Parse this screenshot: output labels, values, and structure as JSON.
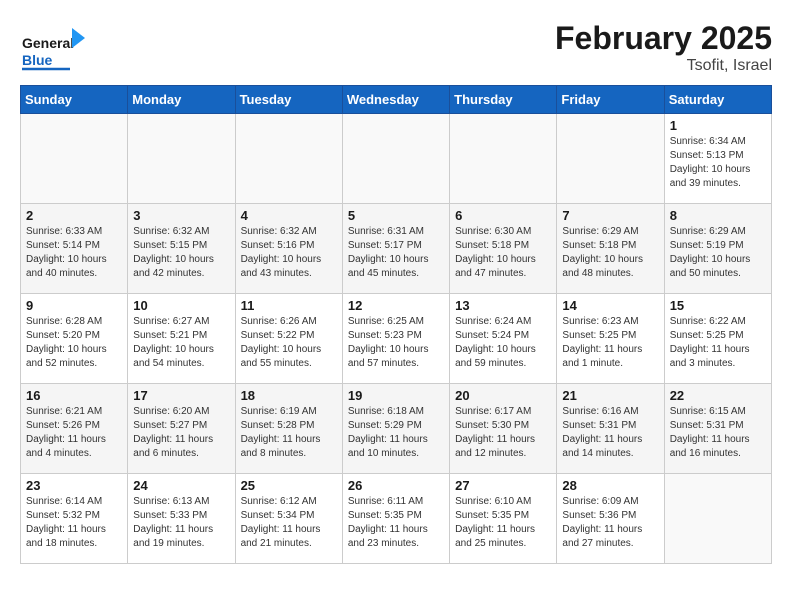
{
  "header": {
    "logo_line1": "General",
    "logo_line2": "Blue",
    "title": "February 2025",
    "subtitle": "Tsofit, Israel"
  },
  "weekdays": [
    "Sunday",
    "Monday",
    "Tuesday",
    "Wednesday",
    "Thursday",
    "Friday",
    "Saturday"
  ],
  "weeks": [
    [
      {
        "day": "",
        "info": ""
      },
      {
        "day": "",
        "info": ""
      },
      {
        "day": "",
        "info": ""
      },
      {
        "day": "",
        "info": ""
      },
      {
        "day": "",
        "info": ""
      },
      {
        "day": "",
        "info": ""
      },
      {
        "day": "1",
        "info": "Sunrise: 6:34 AM\nSunset: 5:13 PM\nDaylight: 10 hours and 39 minutes."
      }
    ],
    [
      {
        "day": "2",
        "info": "Sunrise: 6:33 AM\nSunset: 5:14 PM\nDaylight: 10 hours and 40 minutes."
      },
      {
        "day": "3",
        "info": "Sunrise: 6:32 AM\nSunset: 5:15 PM\nDaylight: 10 hours and 42 minutes."
      },
      {
        "day": "4",
        "info": "Sunrise: 6:32 AM\nSunset: 5:16 PM\nDaylight: 10 hours and 43 minutes."
      },
      {
        "day": "5",
        "info": "Sunrise: 6:31 AM\nSunset: 5:17 PM\nDaylight: 10 hours and 45 minutes."
      },
      {
        "day": "6",
        "info": "Sunrise: 6:30 AM\nSunset: 5:18 PM\nDaylight: 10 hours and 47 minutes."
      },
      {
        "day": "7",
        "info": "Sunrise: 6:29 AM\nSunset: 5:18 PM\nDaylight: 10 hours and 48 minutes."
      },
      {
        "day": "8",
        "info": "Sunrise: 6:29 AM\nSunset: 5:19 PM\nDaylight: 10 hours and 50 minutes."
      }
    ],
    [
      {
        "day": "9",
        "info": "Sunrise: 6:28 AM\nSunset: 5:20 PM\nDaylight: 10 hours and 52 minutes."
      },
      {
        "day": "10",
        "info": "Sunrise: 6:27 AM\nSunset: 5:21 PM\nDaylight: 10 hours and 54 minutes."
      },
      {
        "day": "11",
        "info": "Sunrise: 6:26 AM\nSunset: 5:22 PM\nDaylight: 10 hours and 55 minutes."
      },
      {
        "day": "12",
        "info": "Sunrise: 6:25 AM\nSunset: 5:23 PM\nDaylight: 10 hours and 57 minutes."
      },
      {
        "day": "13",
        "info": "Sunrise: 6:24 AM\nSunset: 5:24 PM\nDaylight: 10 hours and 59 minutes."
      },
      {
        "day": "14",
        "info": "Sunrise: 6:23 AM\nSunset: 5:25 PM\nDaylight: 11 hours and 1 minute."
      },
      {
        "day": "15",
        "info": "Sunrise: 6:22 AM\nSunset: 5:25 PM\nDaylight: 11 hours and 3 minutes."
      }
    ],
    [
      {
        "day": "16",
        "info": "Sunrise: 6:21 AM\nSunset: 5:26 PM\nDaylight: 11 hours and 4 minutes."
      },
      {
        "day": "17",
        "info": "Sunrise: 6:20 AM\nSunset: 5:27 PM\nDaylight: 11 hours and 6 minutes."
      },
      {
        "day": "18",
        "info": "Sunrise: 6:19 AM\nSunset: 5:28 PM\nDaylight: 11 hours and 8 minutes."
      },
      {
        "day": "19",
        "info": "Sunrise: 6:18 AM\nSunset: 5:29 PM\nDaylight: 11 hours and 10 minutes."
      },
      {
        "day": "20",
        "info": "Sunrise: 6:17 AM\nSunset: 5:30 PM\nDaylight: 11 hours and 12 minutes."
      },
      {
        "day": "21",
        "info": "Sunrise: 6:16 AM\nSunset: 5:31 PM\nDaylight: 11 hours and 14 minutes."
      },
      {
        "day": "22",
        "info": "Sunrise: 6:15 AM\nSunset: 5:31 PM\nDaylight: 11 hours and 16 minutes."
      }
    ],
    [
      {
        "day": "23",
        "info": "Sunrise: 6:14 AM\nSunset: 5:32 PM\nDaylight: 11 hours and 18 minutes."
      },
      {
        "day": "24",
        "info": "Sunrise: 6:13 AM\nSunset: 5:33 PM\nDaylight: 11 hours and 19 minutes."
      },
      {
        "day": "25",
        "info": "Sunrise: 6:12 AM\nSunset: 5:34 PM\nDaylight: 11 hours and 21 minutes."
      },
      {
        "day": "26",
        "info": "Sunrise: 6:11 AM\nSunset: 5:35 PM\nDaylight: 11 hours and 23 minutes."
      },
      {
        "day": "27",
        "info": "Sunrise: 6:10 AM\nSunset: 5:35 PM\nDaylight: 11 hours and 25 minutes."
      },
      {
        "day": "28",
        "info": "Sunrise: 6:09 AM\nSunset: 5:36 PM\nDaylight: 11 hours and 27 minutes."
      },
      {
        "day": "",
        "info": ""
      }
    ]
  ]
}
